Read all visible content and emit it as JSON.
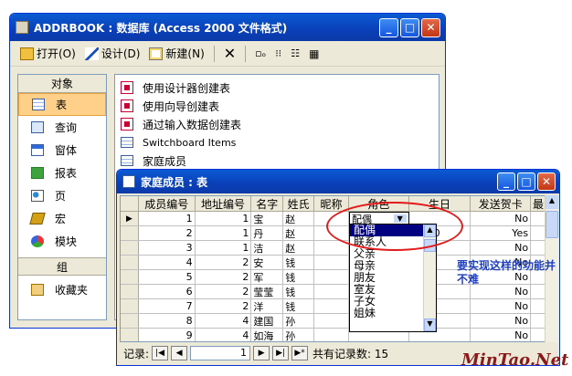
{
  "db_window": {
    "title": "ADDRBOOK : 数据库 (Access 2000 文件格式)",
    "toolbar": {
      "open": "打开(O)",
      "design": "设计(D)",
      "new": "新建(N)"
    },
    "objects_header": "对象",
    "objects": [
      "表",
      "查询",
      "窗体",
      "报表",
      "页",
      "宏",
      "模块"
    ],
    "groups_header": "组",
    "favorites": "收藏夹",
    "list_items": [
      "使用设计器创建表",
      "使用向导创建表",
      "通过输入数据创建表",
      "Switchboard Items",
      "家庭成员"
    ]
  },
  "table_window": {
    "title": "家庭成员 : 表",
    "columns": [
      "成员编号",
      "地址编号",
      "名字",
      "姓氏",
      "昵称",
      "角色",
      "生日",
      "发送贺卡",
      "最"
    ],
    "rows": [
      {
        "id": "1",
        "addr": "1",
        "first": "宝",
        "last": "赵",
        "nick": "",
        "role": "配偶",
        "bday": "",
        "card": "No"
      },
      {
        "id": "2",
        "addr": "1",
        "first": "丹",
        "last": "赵",
        "nick": "",
        "role": "",
        "bday": "10-10",
        "card": "Yes"
      },
      {
        "id": "3",
        "addr": "1",
        "first": "洁",
        "last": "赵",
        "nick": "",
        "role": "",
        "bday": "",
        "card": "No"
      },
      {
        "id": "4",
        "addr": "2",
        "first": "安",
        "last": "钱",
        "nick": "",
        "role": "",
        "bday": "",
        "card": "No"
      },
      {
        "id": "5",
        "addr": "2",
        "first": "军",
        "last": "钱",
        "nick": "",
        "role": "",
        "bday": "",
        "card": "No"
      },
      {
        "id": "6",
        "addr": "2",
        "first": "莹莹",
        "last": "钱",
        "nick": "",
        "role": "",
        "bday": "",
        "card": "No"
      },
      {
        "id": "7",
        "addr": "2",
        "first": "洋",
        "last": "钱",
        "nick": "",
        "role": "",
        "bday": "",
        "card": "No"
      },
      {
        "id": "8",
        "addr": "4",
        "first": "建国",
        "last": "孙",
        "nick": "",
        "role": "",
        "bday": "",
        "card": "No"
      },
      {
        "id": "9",
        "addr": "4",
        "first": "如海",
        "last": "孙",
        "nick": "",
        "role": "",
        "bday": "",
        "card": "No"
      }
    ],
    "nav": {
      "label": "记录:",
      "current": "1",
      "total_label": "共有记录数: 15"
    },
    "dropdown_options": [
      "配偶",
      "联系人",
      "父亲",
      "母亲",
      "朋友",
      "室友",
      "子女",
      "姐妹"
    ]
  },
  "annotation": "要实现这样的功能并不难",
  "watermark": "MinTao.Net"
}
